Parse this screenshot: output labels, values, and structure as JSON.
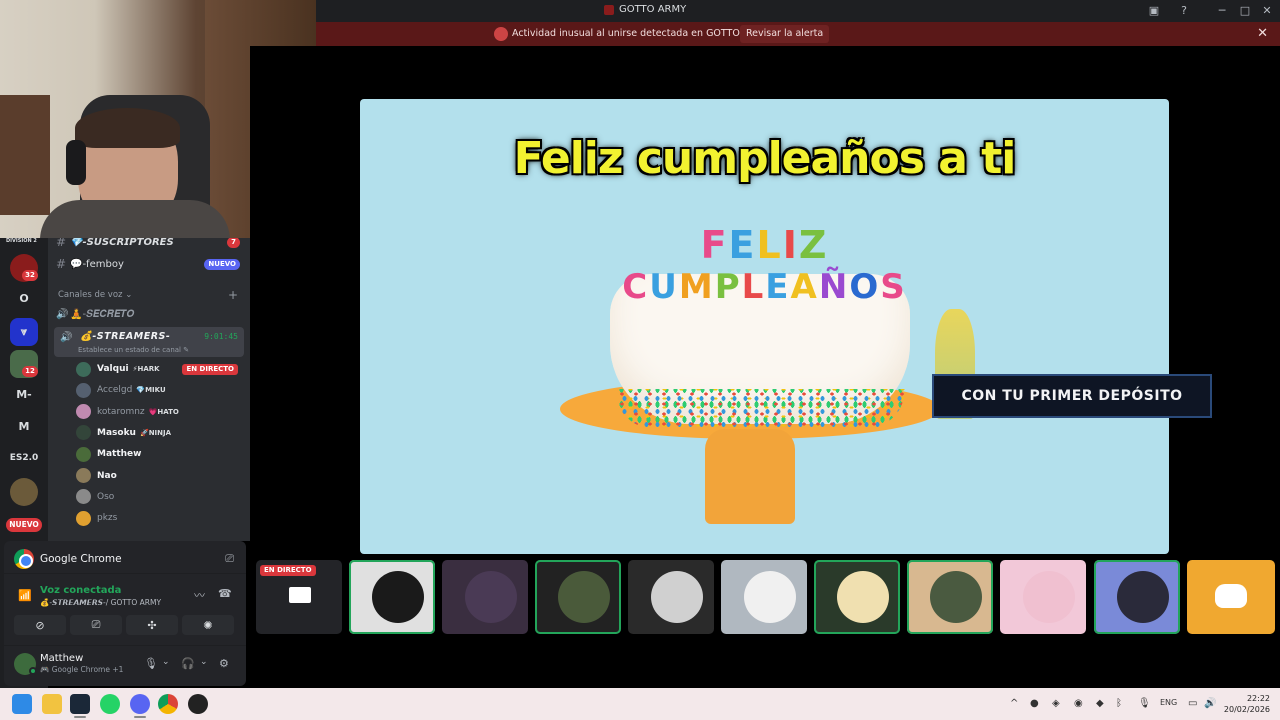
{
  "window": {
    "title": "GOTTO ARMY"
  },
  "alert": {
    "text": "Actividad inusual al unirse detectada en GOTTO ARMY",
    "button": "Revisar la alerta"
  },
  "servers": [
    {
      "label": "",
      "badge": "32",
      "color": "#8a1c1c"
    },
    {
      "label": "O",
      "badge": "",
      "color": "#1e1f22"
    },
    {
      "label": "",
      "badge": "",
      "color": "#2233cc"
    },
    {
      "label": "",
      "badge": "12",
      "color": "#4a6b4a"
    },
    {
      "label": "M-",
      "badge": "",
      "color": "#1e1f22"
    },
    {
      "label": "M",
      "badge": "",
      "color": "#1e1f22"
    },
    {
      "label": "ES2.0",
      "badge": "",
      "color": "#1e1f22"
    },
    {
      "label": "",
      "badge": "",
      "color": "#6b5a3a"
    }
  ],
  "server_nuevo": "NUEVO",
  "server_top_label": "DIVISION 2",
  "channels": {
    "text": [
      {
        "name": "💎-𝙎𝙐𝙎𝘾𝙍𝙄𝙋𝙏𝙊𝙍𝙀𝙎",
        "badge": "7"
      },
      {
        "name": "💬-femboy",
        "badge": "NUEVO"
      }
    ],
    "voice_category": "Canales de voz",
    "voice": [
      {
        "name": "🧘-𝑺𝑬𝑪𝑹𝑬𝑻𝑶"
      }
    ],
    "active_voice": {
      "name": "💰-𝙎𝙏𝙍𝙀𝘼𝙈𝙀𝙍𝙎-",
      "time": "9:01:45",
      "status": "Establece un estado de canal"
    },
    "users": [
      {
        "name": "Valqui",
        "tag": "HARK",
        "tag_icon": "⚡",
        "live": "EN DIRECTO",
        "dim": false,
        "color": "#3d6b5a"
      },
      {
        "name": "Accelgd",
        "tag": "MIKU",
        "tag_icon": "💎",
        "live": "",
        "dim": true,
        "color": "#556070"
      },
      {
        "name": "kotaromnz",
        "tag": "HATO",
        "tag_icon": "💗",
        "live": "",
        "dim": true,
        "color": "#c08ab0"
      },
      {
        "name": "Masoku",
        "tag": "NINJA",
        "tag_icon": "🚀",
        "live": "",
        "dim": false,
        "color": "#33453a"
      },
      {
        "name": "Matthew",
        "tag": "",
        "tag_icon": "",
        "live": "",
        "dim": false,
        "color": "#4a6b3a"
      },
      {
        "name": "Nao",
        "tag": "",
        "tag_icon": "",
        "live": "",
        "dim": false,
        "color": "#8a7a5a"
      },
      {
        "name": "Oso",
        "tag": "",
        "tag_icon": "",
        "live": "",
        "dim": true,
        "color": "#8a8a8a"
      },
      {
        "name": "pkzs",
        "tag": "",
        "tag_icon": "",
        "live": "",
        "dim": true,
        "color": "#e0a030"
      }
    ]
  },
  "voice_panel": {
    "app": "Google Chrome",
    "connected": "Voz conectada",
    "channel": "💰-𝙎𝙏𝙍𝙀𝘼𝙈𝙀𝙍𝙎-/ GOTTO ARMY",
    "user": "Matthew",
    "user_sub": "🎮 Google Chrome +1"
  },
  "stream": {
    "title": "Feliz cumpleaños a ti",
    "candles_line1": [
      "F",
      "E",
      "L",
      "I",
      "Z"
    ],
    "candles_line2": [
      "C",
      "U",
      "M",
      "P",
      "L",
      "E",
      "A",
      "Ñ",
      "O",
      "S"
    ],
    "candle_colors1": [
      "#e84a8a",
      "#3aa0e0",
      "#f0c020",
      "#e84a4a",
      "#7ac040"
    ],
    "candle_colors2": [
      "#e84a8a",
      "#3aa0e0",
      "#f0a020",
      "#7ac040",
      "#e84a4a",
      "#3aa0e0",
      "#f0c020",
      "#9a4ad0",
      "#2a6ad0",
      "#e84a8a"
    ],
    "promo": "CON TU PRIMER DEPÓSITO"
  },
  "tiles": [
    {
      "live": "EN DIRECTO",
      "color": "#1e1f22",
      "bg": "#232428",
      "speaking": false
    },
    {
      "live": "",
      "color": "#1a1a1a",
      "bg": "#e0e0e0",
      "speaking": true
    },
    {
      "live": "",
      "color": "#4a3a55",
      "bg": "#3a2e40",
      "speaking": false
    },
    {
      "live": "",
      "color": "#4a5a3a",
      "bg": "#222",
      "speaking": true
    },
    {
      "live": "",
      "color": "#d0d0d0",
      "bg": "#2a2a2a",
      "speaking": false
    },
    {
      "live": "",
      "color": "#f0f0f0",
      "bg": "#b0b8c0",
      "speaking": false
    },
    {
      "live": "",
      "color": "#f0e0b0",
      "bg": "#2a3a2a",
      "speaking": true
    },
    {
      "live": "",
      "color": "#4a5a40",
      "bg": "#d8b890",
      "speaking": true
    },
    {
      "live": "",
      "color": "#f0c0d0",
      "bg": "#f2c8d8",
      "speaking": false
    },
    {
      "live": "",
      "color": "#2a2a3a",
      "bg": "#7a8ad8",
      "speaking": true
    },
    {
      "live": "",
      "color": "#f0a830",
      "bg": "#f0a830",
      "speaking": false
    }
  ],
  "taskbar": {
    "lang": "ENG",
    "time": "22:22",
    "date": "20/02/2026"
  }
}
